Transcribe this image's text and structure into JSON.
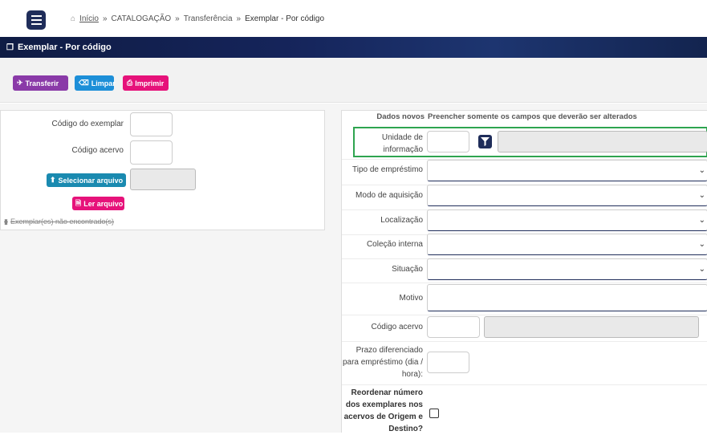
{
  "breadcrumb": {
    "home_label": "Início",
    "items": [
      "CATALOGAÇÃO",
      "Transferência",
      "Exemplar - Por código"
    ]
  },
  "page_title": "Exemplar - Por código",
  "toolbar": {
    "transferir_label": "Transferir",
    "limpar_label": "Limpar",
    "imprimir_label": "Imprimir"
  },
  "left": {
    "codigo_exemplar_label": "Código do exemplar",
    "codigo_acervo_label": "Código acervo",
    "selecionar_arquivo_label": "Selecionar arquivo",
    "ler_arquivo_label": "Ler arquivo",
    "not_found_text": "Exemplar(es) não encontrado(s)"
  },
  "right": {
    "header_left": "Dados novos",
    "header_right": "Preencher somente os campos que deverão ser alterados",
    "unidade_label": "Unidade de informação",
    "tipo_emprestimo_label": "Tipo de empréstimo",
    "modo_aquisicao_label": "Modo de aquisição",
    "localizacao_label": "Localização",
    "colecao_interna_label": "Coleção interna",
    "situacao_label": "Situação",
    "motivo_label": "Motivo",
    "codigo_acervo_label": "Código acervo",
    "prazo_label": "Prazo diferenciado para empréstimo (dia / hora):",
    "reordenar_label": "Reordenar número dos exemplares nos acervos de Origem e Destino?"
  },
  "colors": {
    "navy": "#1f2d5a",
    "purple": "#8a3aa8",
    "blue": "#1d8fd8",
    "pink": "#e6127a",
    "teal": "#1a8ab0",
    "highlight_green": "#2ea44f"
  }
}
